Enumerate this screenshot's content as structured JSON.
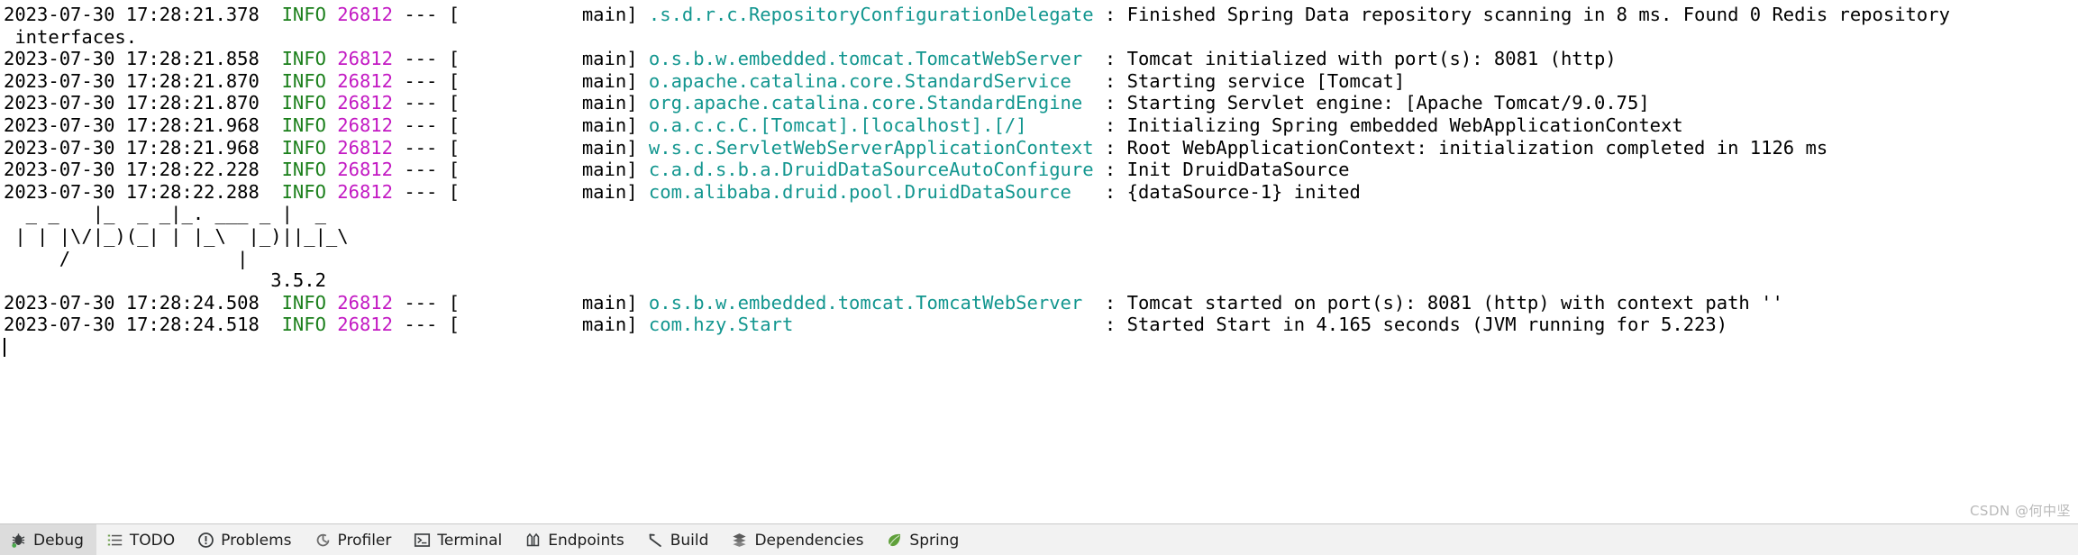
{
  "console": {
    "lines": [
      {
        "type": "log",
        "time": "2023-07-30 17:28:21.378",
        "level": "INFO",
        "pid": "26812",
        "dash": "---",
        "thread": "[           main]",
        "logger": ".s.d.r.c.RepositoryConfigurationDelegate",
        "sep": ":",
        "message": "Finished Spring Data repository scanning in 8 ms. Found 0 Redis repository"
      },
      {
        "type": "cont",
        "text": " interfaces."
      },
      {
        "type": "log",
        "time": "2023-07-30 17:28:21.858",
        "level": "INFO",
        "pid": "26812",
        "dash": "---",
        "thread": "[           main]",
        "logger": "o.s.b.w.embedded.tomcat.TomcatWebServer",
        "sep": ":",
        "message": "Tomcat initialized with port(s): 8081 (http)"
      },
      {
        "type": "log",
        "time": "2023-07-30 17:28:21.870",
        "level": "INFO",
        "pid": "26812",
        "dash": "---",
        "thread": "[           main]",
        "logger": "o.apache.catalina.core.StandardService",
        "sep": ":",
        "message": "Starting service [Tomcat]"
      },
      {
        "type": "log",
        "time": "2023-07-30 17:28:21.870",
        "level": "INFO",
        "pid": "26812",
        "dash": "---",
        "thread": "[           main]",
        "logger": "org.apache.catalina.core.StandardEngine",
        "sep": ":",
        "message": "Starting Servlet engine: [Apache Tomcat/9.0.75]"
      },
      {
        "type": "log",
        "time": "2023-07-30 17:28:21.968",
        "level": "INFO",
        "pid": "26812",
        "dash": "---",
        "thread": "[           main]",
        "logger": "o.a.c.c.C.[Tomcat].[localhost].[/]",
        "sep": ":",
        "message": "Initializing Spring embedded WebApplicationContext"
      },
      {
        "type": "log",
        "time": "2023-07-30 17:28:21.968",
        "level": "INFO",
        "pid": "26812",
        "dash": "---",
        "thread": "[           main]",
        "logger": "w.s.c.ServletWebServerApplicationContext",
        "sep": ":",
        "message": "Root WebApplicationContext: initialization completed in 1126 ms"
      },
      {
        "type": "log",
        "time": "2023-07-30 17:28:22.228",
        "level": "INFO",
        "pid": "26812",
        "dash": "---",
        "thread": "[           main]",
        "logger": "c.a.d.s.b.a.DruidDataSourceAutoConfigure",
        "sep": ":",
        "message": "Init DruidDataSource"
      },
      {
        "type": "log",
        "time": "2023-07-30 17:28:22.288",
        "level": "INFO",
        "pid": "26812",
        "dash": "---",
        "thread": "[           main]",
        "logger": "com.alibaba.druid.pool.DruidDataSource",
        "sep": ":",
        "message": "{dataSource-1} inited"
      },
      {
        "type": "banner",
        "text": "  _ _   |_  _ _|_. ___ _ |  _ "
      },
      {
        "type": "banner",
        "text": " | | |\\/|_)(_| | |_\\  |_)||_|_\\ "
      },
      {
        "type": "banner",
        "text": "     /               |         "
      },
      {
        "type": "banner",
        "text": "                        3.5.2 "
      },
      {
        "type": "log",
        "time": "2023-07-30 17:28:24.508",
        "level": "INFO",
        "pid": "26812",
        "dash": "---",
        "thread": "[           main]",
        "logger": "o.s.b.w.embedded.tomcat.TomcatWebServer",
        "sep": ":",
        "message": "Tomcat started on port(s): 8081 (http) with context path ''"
      },
      {
        "type": "log",
        "time": "2023-07-30 17:28:24.518",
        "level": "INFO",
        "pid": "26812",
        "dash": "---",
        "thread": "[           main]",
        "logger": "com.hzy.Start",
        "sep": ":",
        "message": "Started Start in 4.165 seconds (JVM running for 5.223)"
      },
      {
        "type": "caret"
      }
    ],
    "watermark": "CSDN @何中坚"
  },
  "statusbar": {
    "items": [
      {
        "label": "Debug",
        "icon": "bug-icon",
        "active": true
      },
      {
        "label": "TODO",
        "icon": "todo-list-icon",
        "active": false
      },
      {
        "label": "Problems",
        "icon": "warning-icon",
        "active": false
      },
      {
        "label": "Profiler",
        "icon": "profiler-icon",
        "active": false
      },
      {
        "label": "Terminal",
        "icon": "terminal-icon",
        "active": false
      },
      {
        "label": "Endpoints",
        "icon": "endpoints-icon",
        "active": false
      },
      {
        "label": "Build",
        "icon": "hammer-icon",
        "active": false
      },
      {
        "label": "Dependencies",
        "icon": "dependencies-icon",
        "active": false
      },
      {
        "label": "Spring",
        "icon": "spring-leaf-icon",
        "active": false
      }
    ]
  },
  "colors": {
    "level": "#1a7f1a",
    "pid": "#c319c3",
    "logger": "#12968f",
    "text": "#000000",
    "statusbar_bg": "#f2f2f2",
    "statusbar_active": "#dcdcdc"
  }
}
